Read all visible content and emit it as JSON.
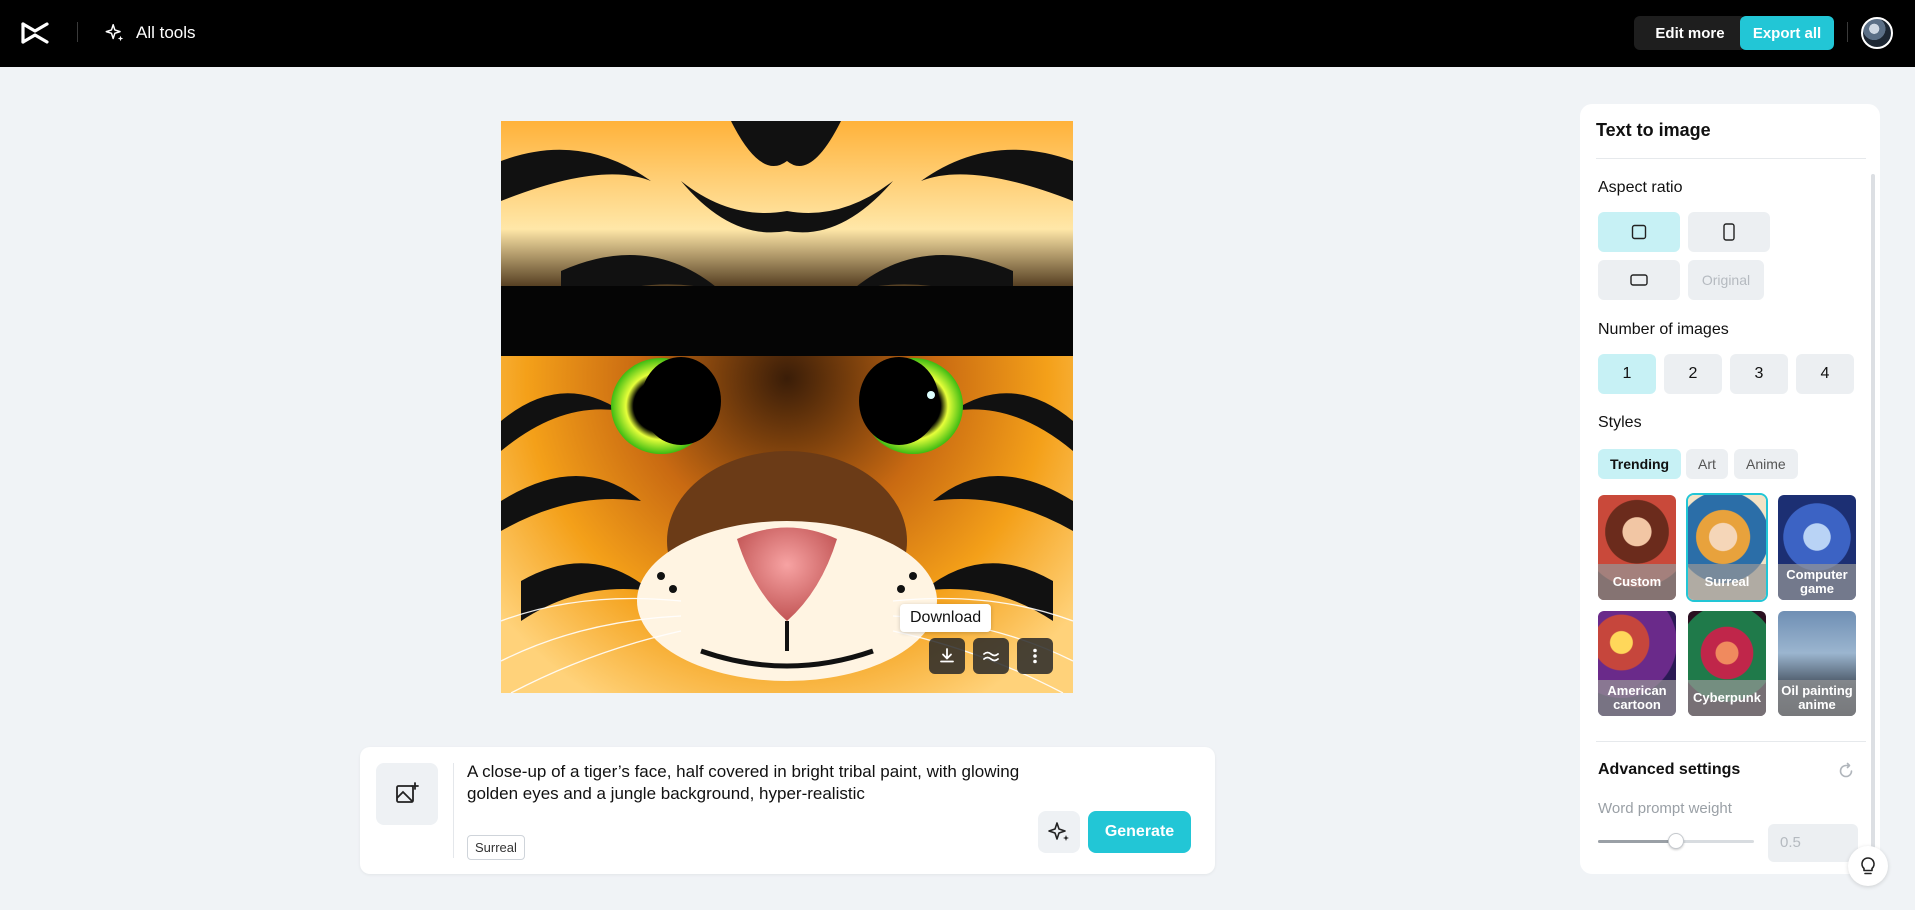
{
  "header": {
    "all_tools_label": "All tools",
    "edit_more_label": "Edit more",
    "export_all_label": "Export all"
  },
  "canvas": {
    "tooltip": "Download"
  },
  "prompt": {
    "text": "A close-up of a tiger’s face, half covered in bright tribal paint, with glowing golden eyes and a jungle background, hyper-realistic",
    "style_chip": "Surreal",
    "generate_label": "Generate"
  },
  "panel": {
    "title": "Text to image",
    "aspect_ratio_label": "Aspect ratio",
    "aspect_original_label": "Original",
    "number_label": "Number of images",
    "numbers": [
      "1",
      "2",
      "3",
      "4"
    ],
    "selected_number": "1",
    "styles_label": "Styles",
    "style_tabs": [
      "Trending",
      "Art",
      "Anime"
    ],
    "selected_tab": "Trending",
    "style_cards": [
      {
        "label": "Custom"
      },
      {
        "label": "Surreal"
      },
      {
        "label": "Computer game"
      },
      {
        "label": "American cartoon"
      },
      {
        "label": "Cyberpunk"
      },
      {
        "label": "Oil painting anime"
      }
    ],
    "selected_style": "Surreal",
    "advanced_label": "Advanced settings",
    "word_prompt_weight_label": "Word prompt weight",
    "word_prompt_weight_value": "0.5"
  },
  "colors": {
    "accent": "#22c6d6",
    "selected_bg": "#c7f1f5"
  }
}
